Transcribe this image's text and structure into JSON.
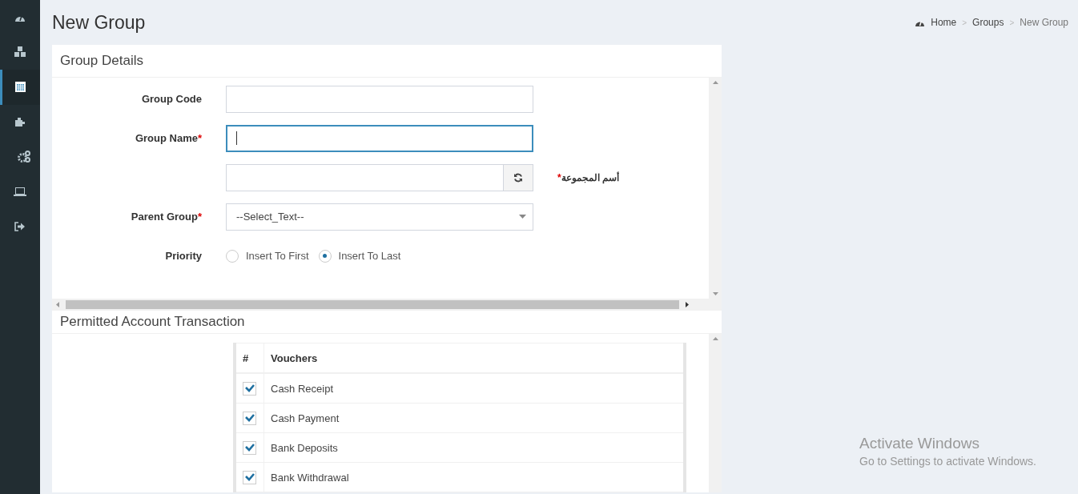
{
  "sidebar": {
    "items": [
      {
        "selected": false
      },
      {
        "selected": false
      },
      {
        "selected": true
      },
      {
        "selected": false
      },
      {
        "selected": false
      },
      {
        "selected": false
      },
      {
        "selected": false
      }
    ]
  },
  "page_title": "New Group",
  "breadcrumb": [
    {
      "kind": "link",
      "label": "Home"
    },
    {
      "kind": "separator",
      "label": ">"
    },
    {
      "kind": "link",
      "label": "Groups"
    },
    {
      "kind": "separator",
      "label": ">"
    },
    {
      "kind": "current",
      "label": "New Group"
    }
  ],
  "group_details": {
    "title": "Group Details",
    "fields": [
      {
        "kind": "text",
        "label": "Group Code",
        "focused": false
      },
      {
        "kind": "text",
        "label": "Group Name",
        "required_mark": "*",
        "focused": true
      },
      {
        "kind": "arabic",
        "label": "أسم المجموعة",
        "required_mark": "*"
      },
      {
        "kind": "select",
        "label": "Parent Group",
        "required_mark": "*",
        "value": "--Select_Text--"
      },
      {
        "kind": "radio",
        "label": "Priority",
        "options": [
          {
            "label": "Insert To First",
            "selected": false
          },
          {
            "label": "Insert To Last",
            "selected": true
          }
        ]
      }
    ]
  },
  "permitted": {
    "title": "Permitted Account Transaction",
    "columns": [
      "#",
      "Vouchers"
    ],
    "rows": [
      {
        "label": "Cash Receipt",
        "checked": true
      },
      {
        "label": "Cash Payment",
        "checked": true
      },
      {
        "label": "Bank Deposits",
        "checked": true
      },
      {
        "label": "Bank Withdrawal",
        "checked": true
      }
    ]
  },
  "os_notice": {
    "title": "Activate Windows",
    "text": "Go to Settings to activate Windows."
  }
}
